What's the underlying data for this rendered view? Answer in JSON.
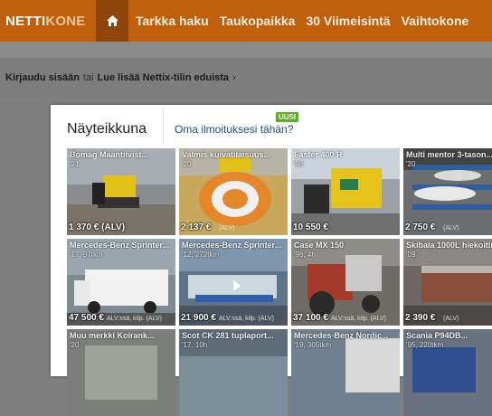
{
  "nav": {
    "logo_part1": "NETTI",
    "logo_part2": "KONE",
    "home_icon": "home-icon",
    "links": [
      "Tarkka haku",
      "Taukopaikka",
      "30 Viimeisintä",
      "Vaihtokone"
    ]
  },
  "login_bar": {
    "login_link": "Kirjaudu sisään",
    "or_text": "tai",
    "learn_link": "Lue lisää Nettix-tilin eduista",
    "chevron": "›"
  },
  "showcase": {
    "title": "Näyteikkuna",
    "own_ad_link": "Oma ilmoituksesi tähän?",
    "new_badge": "UUSI",
    "tiles": [
      {
        "title": "Bomag Maantiivist...",
        "sub": "'21",
        "price": "1 370 € (ALV)",
        "vat": ""
      },
      {
        "title": "Valmis kuivatilaisuus...",
        "sub": "'20",
        "price": "2 137 €",
        "vat": "(ALV)"
      },
      {
        "title": "Faster 400 R",
        "sub": "'96",
        "price": "10 550 €",
        "vat": ""
      },
      {
        "title": "Multi mentor 3-tason...",
        "sub": "'20",
        "price": "2 750 €",
        "vat": "(ALV)"
      },
      {
        "title": "Mercedes-Benz Sprinter...",
        "sub": "'17, 97tkm",
        "price": "47 500 €",
        "vat": "ALV:ssä, kilp. (ALV)"
      },
      {
        "title": "Mercedes-Benz Sprinter...",
        "sub": "'12, 272tkm",
        "price": "21 900 €",
        "vat": "ALV:ssä, kilp. (ALV)"
      },
      {
        "title": "Case MX 150",
        "sub": "'96, 4h",
        "price": "37 100 €",
        "vat": "ALV:ssä, kilp. (ALV)"
      },
      {
        "title": "Skibala 1000L hiekoitin...",
        "sub": "'09",
        "price": "2 390 €",
        "vat": "(ALV)"
      },
      {
        "title": "Muu merkki Koirank...",
        "sub": "'20",
        "price": "",
        "vat": ""
      },
      {
        "title": "Scot CK 281 tuplaport...",
        "sub": "'17, 10h",
        "price": "",
        "vat": ""
      },
      {
        "title": "Mercedes-Benz Nordic...",
        "sub": "'19, 305tkm",
        "price": "",
        "vat": ""
      },
      {
        "title": "Scania P94DB...",
        "sub": "'95, 220tkm",
        "price": "",
        "vat": ""
      }
    ]
  },
  "colors": {
    "nav_bg": "#c05f0c",
    "home_bg": "#8e4507",
    "page_bg": "#7f7f7f",
    "link_blue": "#1a4f8b",
    "badge_green": "#5cae22"
  }
}
